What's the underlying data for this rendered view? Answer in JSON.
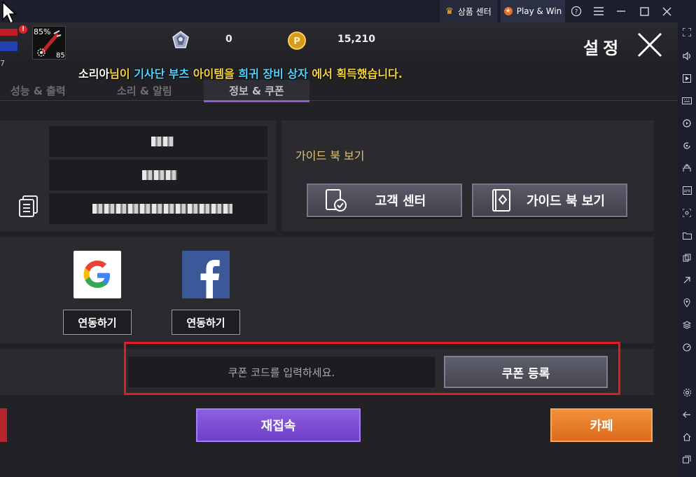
{
  "titlebar": {
    "store_label": "상품 센터",
    "play_label": "Play & Win",
    "icons": [
      "help-icon",
      "menu-icon",
      "minimize-icon",
      "maximize-icon",
      "close-icon"
    ]
  },
  "sidebar": {
    "icons": [
      "fullscreen-icon",
      "volume-icon",
      "media-icon",
      "keyboard-icon",
      "macro-icon",
      "rotate-icon",
      "multi-instance-icon",
      "apk-icon",
      "screenshot-icon",
      "folder-icon",
      "resize-icon",
      "eco-mode-icon",
      "location-icon",
      "layers-icon",
      "speed-icon",
      "settings-icon",
      "back-icon",
      "home-icon",
      "recent-apps-icon"
    ]
  },
  "hud": {
    "alert_badge": "!",
    "potion_percent": "85%",
    "potion_count": "85",
    "left_level": "7",
    "gems": "0",
    "gold": "15,210",
    "settings_title": "설정"
  },
  "notice": {
    "player": "소리아",
    "part1": "님이 ",
    "item": "기사단 부츠",
    "part2": " 아이템을 ",
    "source": "희귀 장비 상자",
    "part3": " 에서 획득했습니다."
  },
  "tabs": [
    "성능 & 출력",
    "소리 & 알림",
    "정보 & 쿠폰"
  ],
  "active_tab": 2,
  "guide": {
    "label": "가이드 북 보기",
    "customer_center": "고객 센터",
    "guide_book": "가이드 북 보기"
  },
  "social": {
    "google_link": "연동하기",
    "facebook_link": "연동하기"
  },
  "coupon": {
    "placeholder": "쿠폰 코드를 입력하세요.",
    "register": "쿠폰 등록"
  },
  "bottom": {
    "reconnect": "재접속",
    "cafe": "카페"
  },
  "colors": {
    "accent_purple": "#8a5cd6",
    "highlight_red": "#e01c24",
    "cafe_orange": "#ea7d2a",
    "notice_yellow": "#f5d23a",
    "notice_cyan": "#4fd3ff"
  }
}
